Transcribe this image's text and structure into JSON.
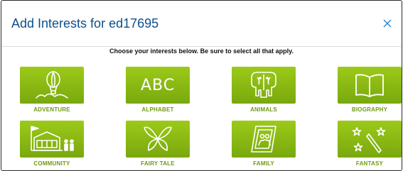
{
  "dialog": {
    "title": "Add Interests for ed17695",
    "instructions": "Choose your interests below. Be sure to select all that apply.",
    "close_icon": "close-icon"
  },
  "interests": [
    {
      "label": "ADVENTURE",
      "icon": "hot-air-balloon-icon"
    },
    {
      "label": "ALPHABET",
      "icon": "abc-icon",
      "icon_text": "ABC"
    },
    {
      "label": "ANIMALS",
      "icon": "elephants-icon"
    },
    {
      "label": "BIOGRAPHY",
      "icon": "open-book-icon"
    },
    {
      "label": "COMMUNITY",
      "icon": "school-building-icon"
    },
    {
      "label": "FAIRY TALE",
      "icon": "butterfly-icon"
    },
    {
      "label": "FAMILY",
      "icon": "picture-frame-icon"
    },
    {
      "label": "FANTASY",
      "icon": "magic-wand-icon"
    }
  ],
  "colors": {
    "title": "#0d4f8a",
    "tile_green": "#8cbd15",
    "label_green": "#6f9a10",
    "close_blue": "#2c86c9"
  }
}
